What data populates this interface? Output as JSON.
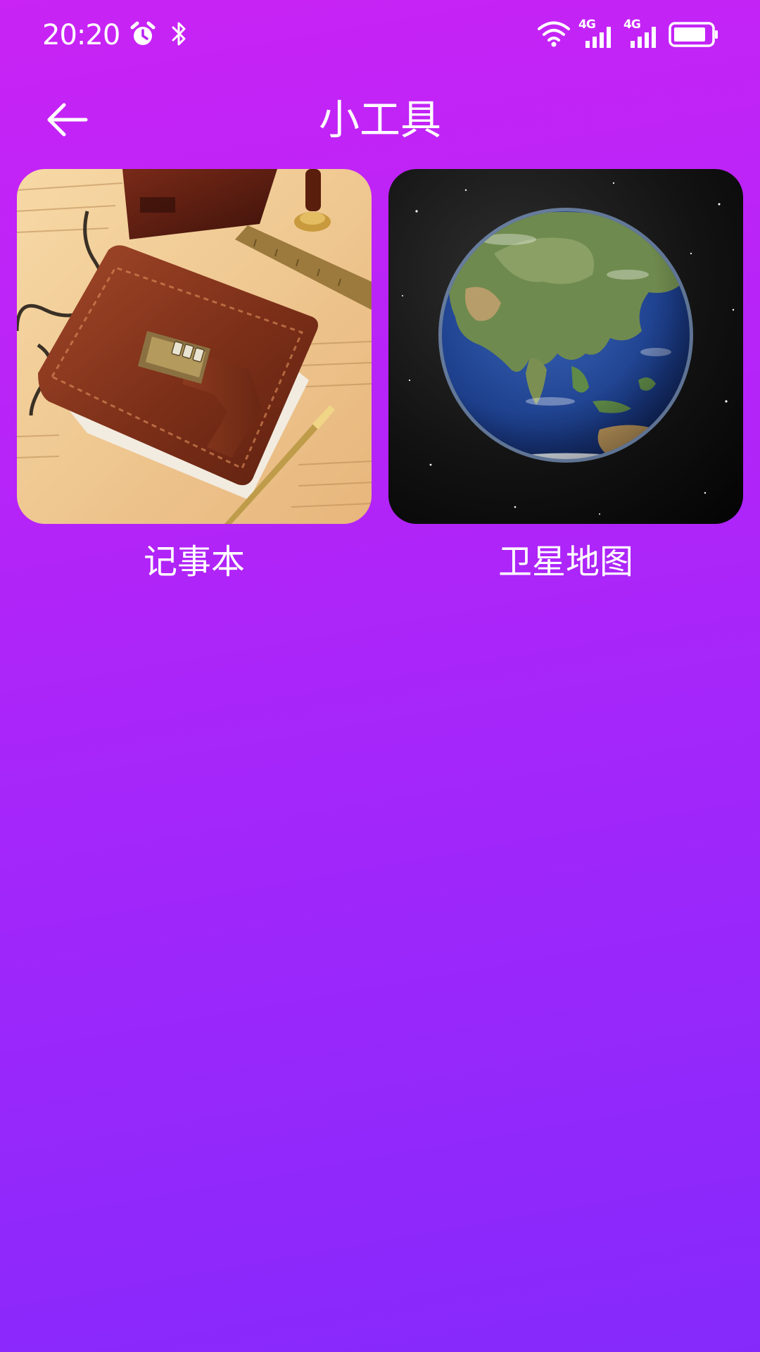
{
  "status_bar": {
    "time": "20:20",
    "network_left": "4G",
    "network_right": "4G"
  },
  "header": {
    "title": "小工具"
  },
  "tools": [
    {
      "label": "记事本",
      "icon": "notebook-image"
    },
    {
      "label": "卫星地图",
      "icon": "satellite-earth-image"
    }
  ],
  "colors": {
    "gradient_top": "#c923f5",
    "gradient_bottom": "#8529fb",
    "text": "#ffffff"
  }
}
